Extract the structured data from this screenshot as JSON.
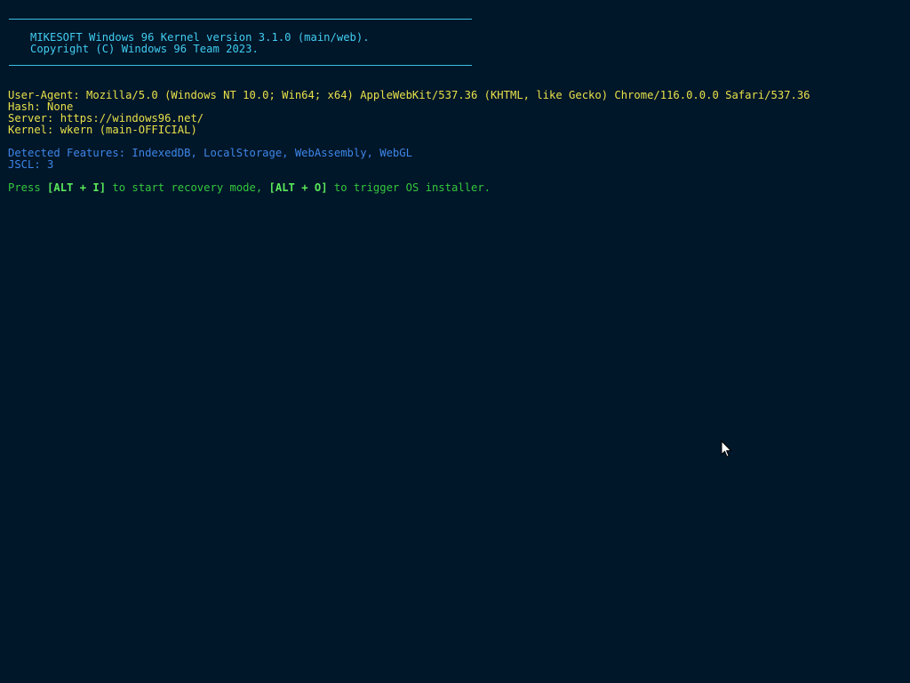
{
  "header": {
    "title_line": "MIKESOFT Windows 96 Kernel version 3.1.0 (main/web).",
    "copyright_line": "Copyright (C) Windows 96 Team 2023."
  },
  "info": {
    "user_agent": "User-Agent: Mozilla/5.0 (Windows NT 10.0; Win64; x64) AppleWebKit/537.36 (KHTML, like Gecko) Chrome/116.0.0.0 Safari/537.36",
    "hash": "Hash: None",
    "server": "Server: https://windows96.net/",
    "kernel": "Kernel: wkern (main-OFFICIAL)"
  },
  "features": {
    "detected": "Detected Features: IndexedDB, LocalStorage, WebAssembly, WebGL",
    "jscl": "JSCL: 3"
  },
  "prompt": {
    "press": "Press ",
    "key_recovery": "[ALT + I]",
    "mid": " to start recovery mode, ",
    "key_installer": "[ALT + O]",
    "end": " to trigger OS installer."
  },
  "colors": {
    "background": "#001629",
    "header": "#41cdf0",
    "info": "#e8e049",
    "features": "#3f86e8",
    "prompt": "#34c83c"
  },
  "icons": {
    "cursor": "mouse-pointer-icon"
  }
}
